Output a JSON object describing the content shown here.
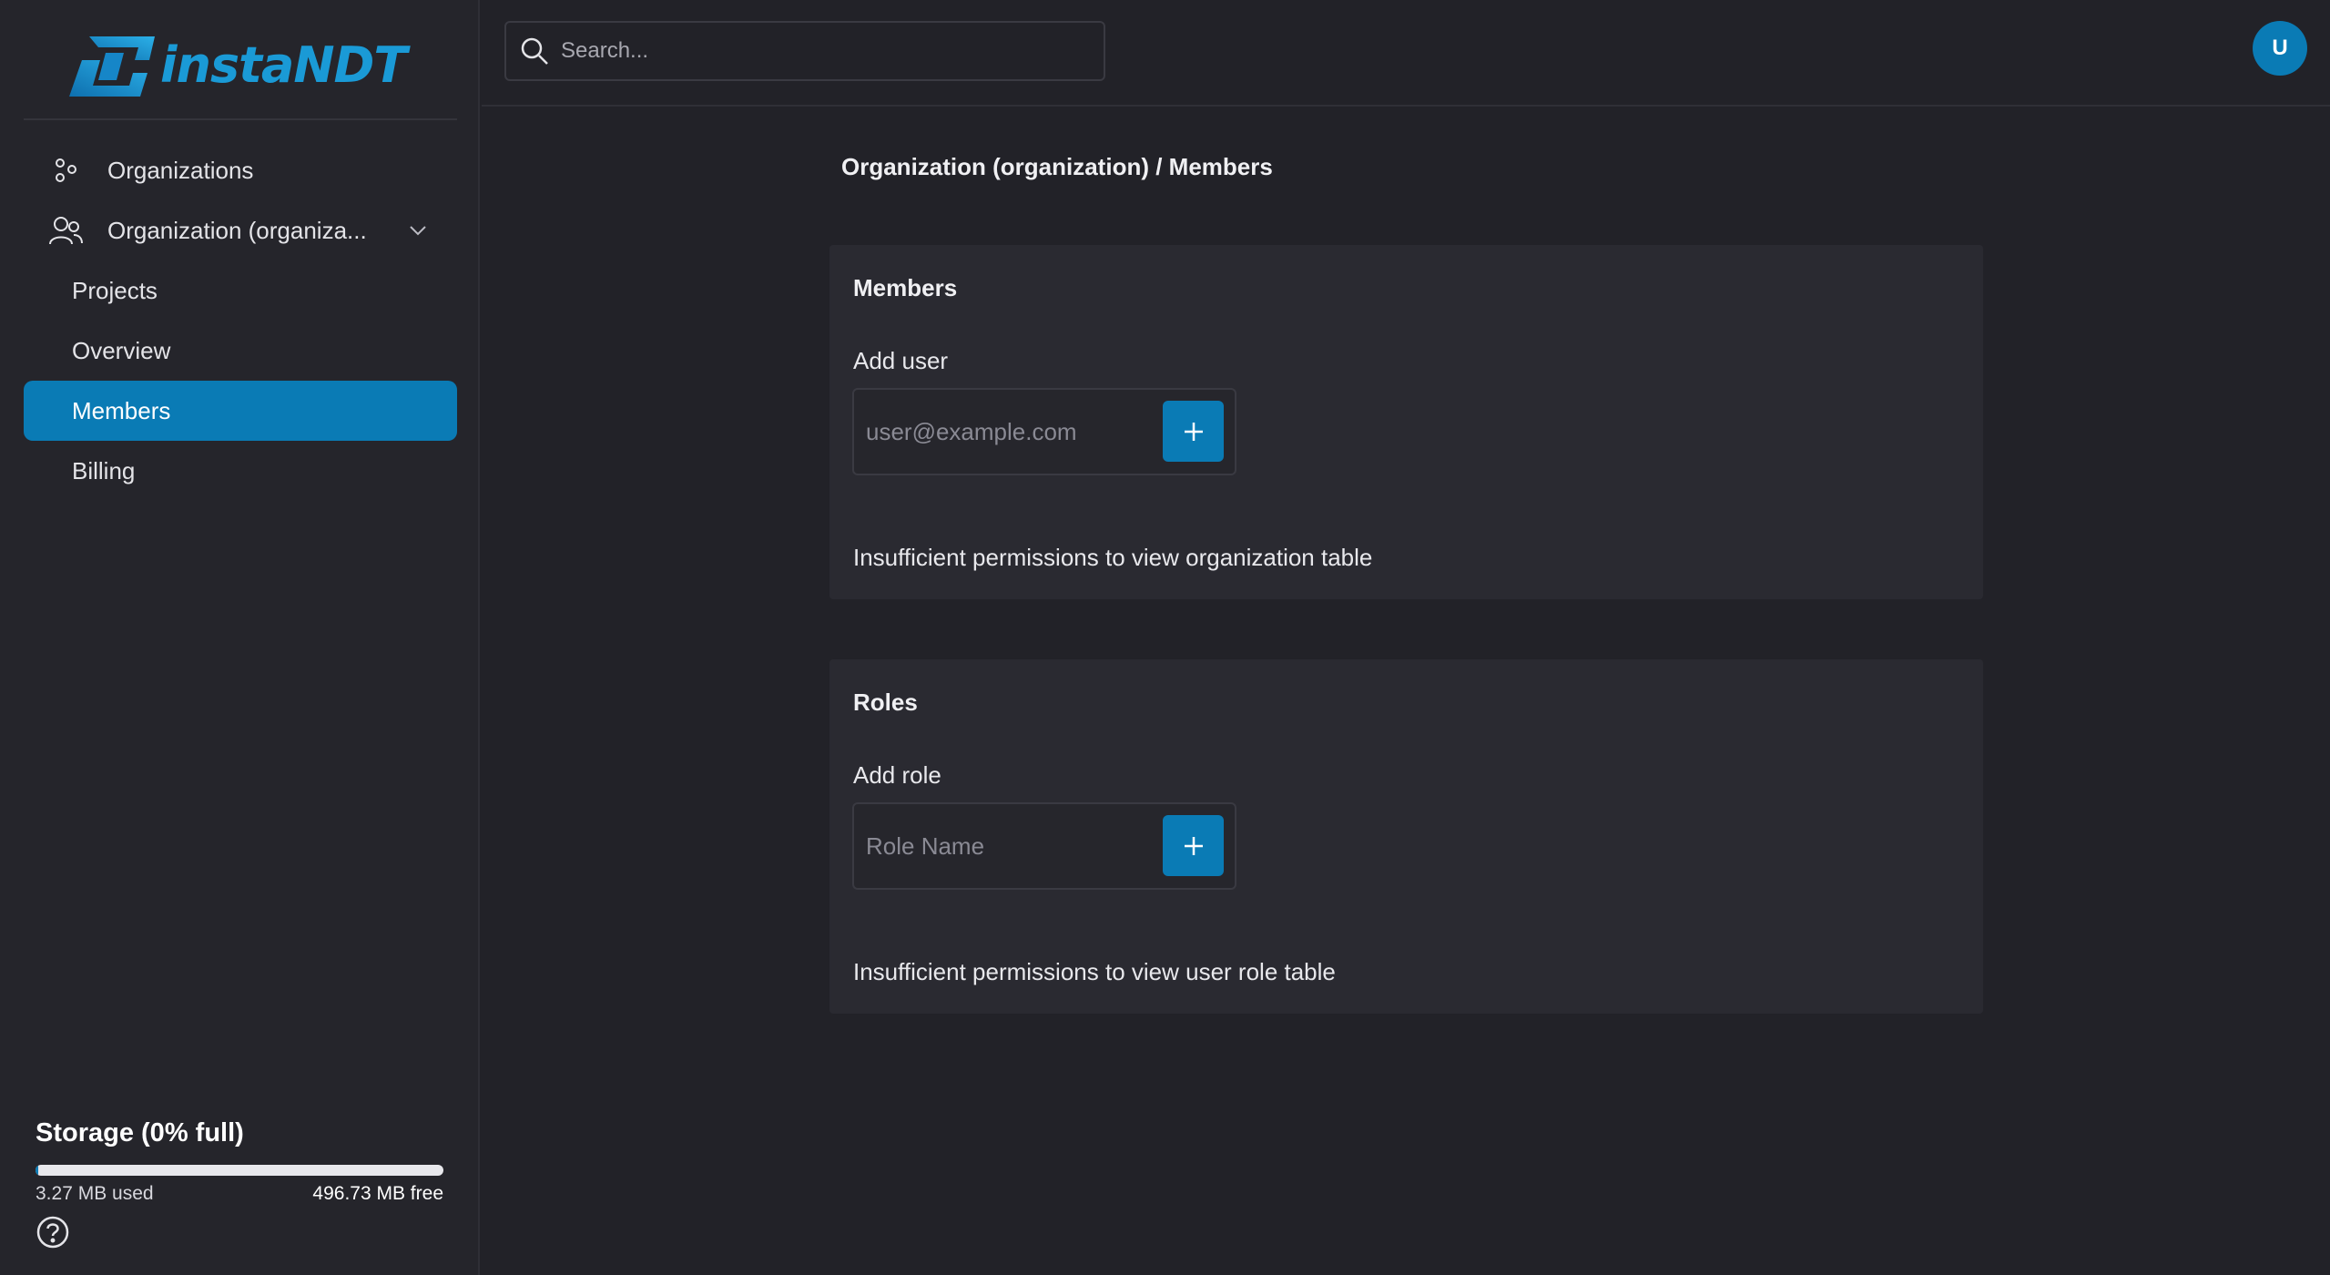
{
  "brand": {
    "name": "instaNDT",
    "color": "#1a9ad6"
  },
  "accent": "#0a7bb5",
  "sidebar": {
    "items": [
      {
        "label": "Organizations",
        "icon": "organizations-icon"
      },
      {
        "label": "Organization (organiza...",
        "icon": "users-icon",
        "expandable": true
      },
      {
        "label": "Projects"
      },
      {
        "label": "Overview"
      },
      {
        "label": "Members",
        "active": true
      },
      {
        "label": "Billing"
      }
    ],
    "storage": {
      "title": "Storage (0% full)",
      "used": "3.27 MB used",
      "free": "496.73 MB free",
      "percent": 0.65
    }
  },
  "header": {
    "search_placeholder": "Search...",
    "avatar_initial": "U"
  },
  "main": {
    "breadcrumb": "Organization (organization) / Members",
    "members_card": {
      "title": "Members",
      "label": "Add user",
      "placeholder": "user@example.com",
      "message": "Insufficient permissions to view organization table"
    },
    "roles_card": {
      "title": "Roles",
      "label": "Add role",
      "placeholder": "Role Name",
      "message": "Insufficient permissions to view user role table"
    }
  }
}
